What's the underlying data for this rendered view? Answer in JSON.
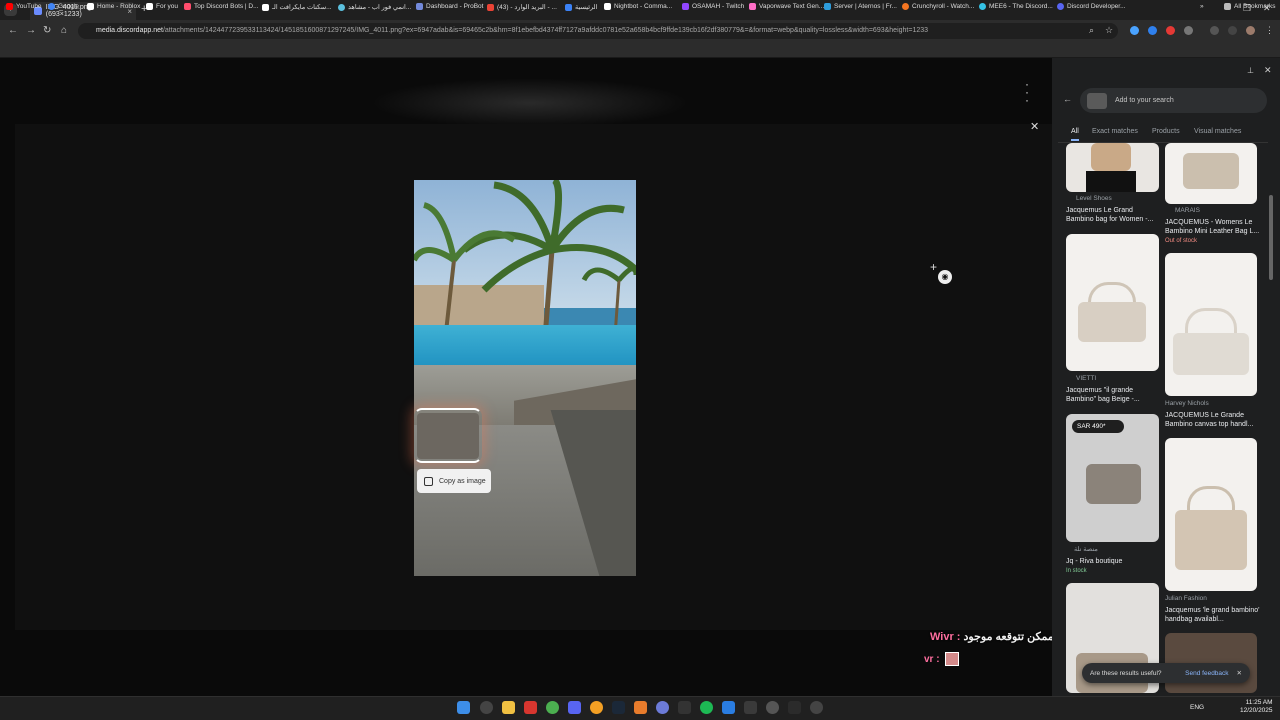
{
  "browser": {
    "tab_title": "IMG_4011.png (693×1233)",
    "tab_close": "×",
    "new_tab": "+",
    "url_domain": "media.discordapp.net",
    "url_rest": "/attachments/1424477239533113424/1451851600871297245/IMG_4011.png?ex=6947adab&is=69465c2b&hm=8f1ebefbd4374ff7127a9afddc0781e52a658b4bcf9ffde139cb16f2df380779&=&format=webp&quality=lossless&width=693&height=1233",
    "all_bookmarks": "All Bookmarks",
    "bookmarks": [
      {
        "label": "YouTube",
        "color": "#ff0000"
      },
      {
        "label": "Google",
        "color": "#4285f4"
      },
      {
        "label": "Home - Roblox",
        "color": "#ffffff"
      },
      {
        "label": "For you",
        "color": "#ffffff"
      },
      {
        "label": "Top Discord Bots | D...",
        "color": "#ff4d6d"
      },
      {
        "label": "سكنات مايكرافت الـ...",
        "color": "#ffffff"
      },
      {
        "label": "انمي فور اب - مشاهد...",
        "color": "#5bc0de"
      },
      {
        "label": "Dashboard - ProBot",
        "color": "#7289da"
      },
      {
        "label": "(43) - البريد الوارد - ...",
        "color": "#ea4335"
      },
      {
        "label": "الرئيسية",
        "color": "#3b82f6"
      },
      {
        "label": "Nightbot - Comma...",
        "color": "#ffffff"
      },
      {
        "label": "OSAMAH - Twitch",
        "color": "#9146ff"
      },
      {
        "label": "Vaporwave Text Gen...",
        "color": "#ff6ec7"
      },
      {
        "label": "Server | Aternos | Fr...",
        "color": "#2d9cdb"
      },
      {
        "label": "Crunchyroll - Watch...",
        "color": "#f47521"
      },
      {
        "label": "MEE6 - The Discord...",
        "color": "#35c3e6"
      },
      {
        "label": "Discord Developer...",
        "color": "#5865f2"
      }
    ]
  },
  "viewer": {
    "copy_as_image": "Copy as image",
    "overlay_message_user": "Wivr : ",
    "overlay_message_text": "كل شي ممكن تتوقعه موجود",
    "overlay_second_user": "vr : "
  },
  "lens": {
    "search_placeholder": "Add to your search",
    "tabs": [
      "All",
      "Exact matches",
      "Products",
      "Visual matches"
    ],
    "results": [
      {
        "source": "Level Shoes",
        "title": "Jacquemus Le Grand Bambino bag for Women -..."
      },
      {
        "source": "MARAIS",
        "title": "JACQUEMUS - Womens Le Bambino Mini Leather Bag L...",
        "stock": "Out of stock"
      },
      {
        "source": "VIETTI",
        "title": "Jacquemus \"il grande Bambino\" bag Beige -..."
      },
      {
        "source": "Harvey Nichols",
        "title": "JACQUEMUS Le Grande Bambino canvas top handl..."
      },
      {
        "source": "منصة نلة",
        "title": "Jq - Riva boutique",
        "stock": "In stock",
        "price": "SAR 490*"
      },
      {
        "source": "Julian Fashion",
        "title": "Jacquemus 'le grand bambino' handbag availabl..."
      }
    ],
    "feedback_question": "Are these results useful?",
    "feedback_send": "Send feedback"
  },
  "system": {
    "language": "ENG",
    "time": "11:25 AM",
    "date": "12/20/2025"
  }
}
